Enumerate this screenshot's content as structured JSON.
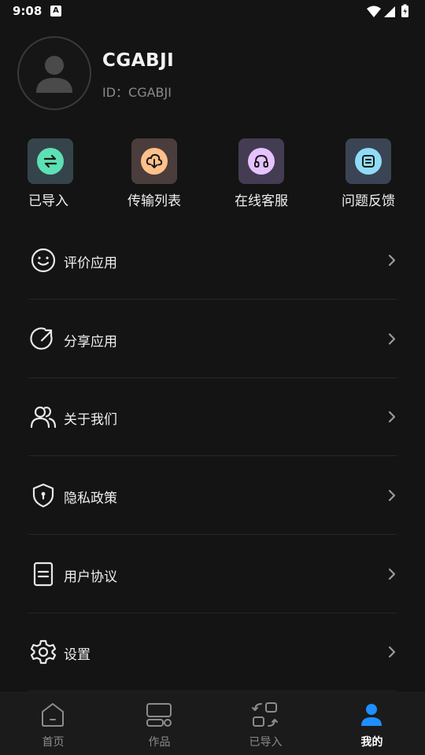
{
  "status_bar": {
    "time": "9:08",
    "notification_glyph": "A"
  },
  "profile": {
    "name": "CGABJI",
    "id_text": "ID：CGABJI"
  },
  "quick_actions": [
    {
      "label": "已导入",
      "icon": "swap-arrows-icon",
      "bg": "#34444a",
      "circle": "#5ce0b4"
    },
    {
      "label": "传输列表",
      "icon": "cloud-download-icon",
      "bg": "#4a3d3c",
      "circle": "#ffc08a"
    },
    {
      "label": "在线客服",
      "icon": "headset-icon",
      "bg": "#433c52",
      "circle": "#e6c2ff"
    },
    {
      "label": "问题反馈",
      "icon": "feedback-icon",
      "bg": "#3b4454",
      "circle": "#8fdcf7"
    }
  ],
  "menu": [
    {
      "label": "评价应用",
      "icon": "smile-icon"
    },
    {
      "label": "分享应用",
      "icon": "share-icon"
    },
    {
      "label": "关于我们",
      "icon": "users-icon"
    },
    {
      "label": "隐私政策",
      "icon": "shield-icon"
    },
    {
      "label": "用户协议",
      "icon": "document-icon"
    },
    {
      "label": "设置",
      "icon": "gear-icon"
    }
  ],
  "tabs": [
    {
      "label": "首页",
      "icon": "home-icon",
      "active": false
    },
    {
      "label": "作品",
      "icon": "works-icon",
      "active": false
    },
    {
      "label": "已导入",
      "icon": "imported-icon",
      "active": false
    },
    {
      "label": "我的",
      "icon": "person-icon",
      "active": true
    }
  ],
  "colors": {
    "background": "#141414",
    "tab_active": "#1e8fff",
    "text_secondary": "#8a8a8a"
  }
}
